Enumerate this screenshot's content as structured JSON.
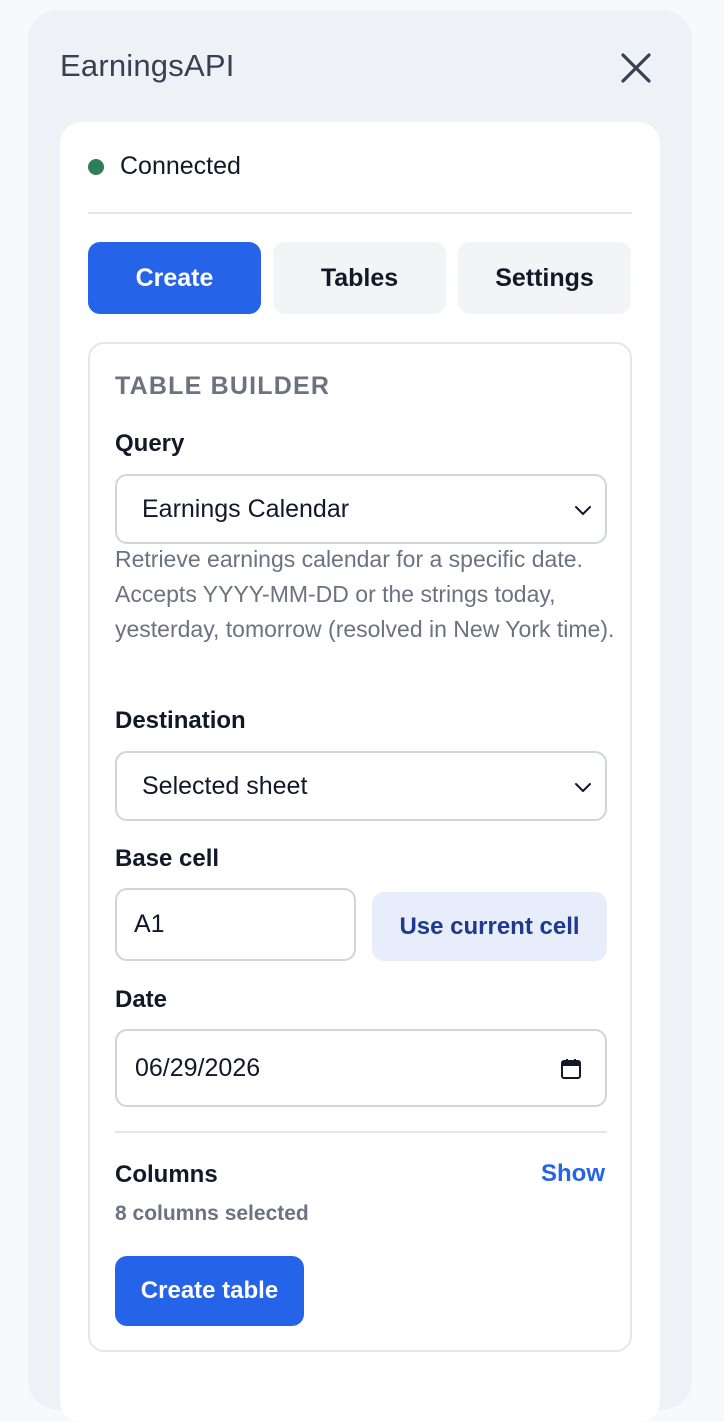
{
  "app": {
    "title": "EarningsAPI"
  },
  "status": {
    "text": "Connected",
    "color": "#2e7d5b"
  },
  "tabs": [
    {
      "label": "Create",
      "active": true
    },
    {
      "label": "Tables",
      "active": false
    },
    {
      "label": "Settings",
      "active": false
    }
  ],
  "builder": {
    "section_title": "TABLE BUILDER",
    "query": {
      "label": "Query",
      "selected": "Earnings Calendar",
      "help": "Retrieve earnings calendar for a specific date. Accepts YYYY-MM-DD or the strings today, yesterday, tomorrow (resolved in New York time)."
    },
    "destination": {
      "label": "Destination",
      "selected": "Selected sheet"
    },
    "base_cell": {
      "label": "Base cell",
      "value": "A1",
      "button_label": "Use current cell"
    },
    "date": {
      "label": "Date",
      "value": "06/29/2026"
    },
    "columns": {
      "label": "Columns",
      "toggle_label": "Show",
      "summary": "8 columns selected"
    },
    "submit_label": "Create table"
  },
  "colors": {
    "accent": "#2563e8",
    "panel_bg": "#eef2f7",
    "secondary_button_bg": "#e8edfb"
  },
  "icons": {
    "close": "close-icon",
    "dropdown": "chevron-down-icon",
    "date": "calendar-icon"
  }
}
